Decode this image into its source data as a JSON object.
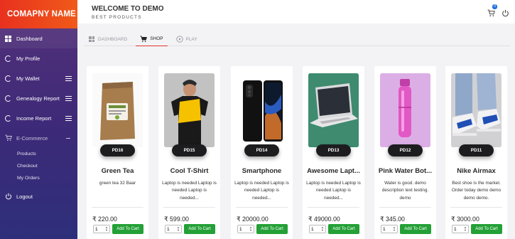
{
  "brand": "COMAPNY NAME",
  "header": {
    "title": "WELCOME TO DEMO",
    "subtitle": "BEST PRODUCTS",
    "cart_count": "0"
  },
  "sidebar": {
    "items": [
      {
        "label": "Dashboard",
        "icon": "dashboard-icon"
      },
      {
        "label": "My Profile",
        "icon": "circle-icon"
      },
      {
        "label": "My Wallet",
        "icon": "circle-icon"
      },
      {
        "label": "Genealogy Report",
        "icon": "circle-icon"
      },
      {
        "label": "Income Report",
        "icon": "circle-icon"
      },
      {
        "label": "E-Commerce",
        "icon": "cart-icon"
      },
      {
        "label": "Logout",
        "icon": "power-icon"
      }
    ],
    "ecommerce_sub": [
      "Products",
      "Checkout",
      "My Orders"
    ]
  },
  "tabs": [
    {
      "label": "DASHBOARD",
      "icon": "grid-icon"
    },
    {
      "label": "SHOP",
      "icon": "cart-icon"
    },
    {
      "label": "PLAY",
      "icon": "play-icon"
    }
  ],
  "products": [
    {
      "code": "PD16",
      "name": "Green Tea",
      "desc": "green tea 32 Baar",
      "price": "₹ 220.00",
      "qty": "1"
    },
    {
      "code": "PD15",
      "name": "Cool T-Shirt",
      "desc": "Laptop is needed Laptop is needed Laptop is needed...",
      "price": "₹ 599.00",
      "qty": "1"
    },
    {
      "code": "PD14",
      "name": "Smartphone",
      "desc": "Laptop is needed Laptop is needed Laptop is needed...",
      "price": "₹ 20000.00",
      "qty": "1"
    },
    {
      "code": "PD13",
      "name": "Awesome Lapt...",
      "desc": "Laptop is needed Laptop is needed Laptop is needed...",
      "price": "₹ 49000.00",
      "qty": "1"
    },
    {
      "code": "PD12",
      "name": "Pink Water Bot...",
      "desc": "Water is good. demo description text testing. demo",
      "price": "₹ 345.00",
      "qty": "1"
    },
    {
      "code": "PD11",
      "name": "Nike Airmax",
      "desc": "Best shoe is the market. Order today demo demo demo demo.",
      "price": "₹ 3000.00",
      "qty": "1"
    }
  ],
  "add_to_cart_label": "Add To Cart",
  "colors": {
    "brand_red": "#e8311f",
    "sidebar_purple": "#3c2a78",
    "add_button_green": "#23a036",
    "active_tab_underline": "#e0342a",
    "badge_blue": "#1e6fe0"
  }
}
